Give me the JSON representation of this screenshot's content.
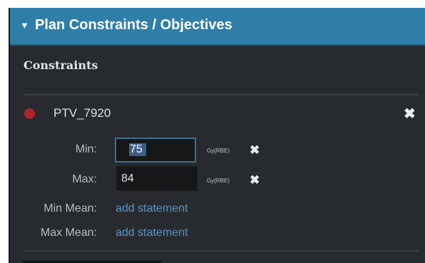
{
  "panel": {
    "collapse_glyph": "▼",
    "title": "Plan Constraints / Objectives",
    "header_color": "#2f7ea8"
  },
  "constraints": {
    "heading": "Constraints",
    "structure": {
      "status_color": "#b0232a",
      "name": "PTV_7920",
      "remove_icon": "close-icon"
    },
    "rows": {
      "min": {
        "label": "Min:",
        "value": "75",
        "unit": "Gy(RBE)"
      },
      "max": {
        "label": "Max:",
        "value": "84",
        "unit": "Gy(RBE)"
      },
      "min_mean": {
        "label": "Min Mean:",
        "link": "add statement"
      },
      "max_mean": {
        "label": "Max Mean:",
        "link": "add statement"
      }
    }
  }
}
